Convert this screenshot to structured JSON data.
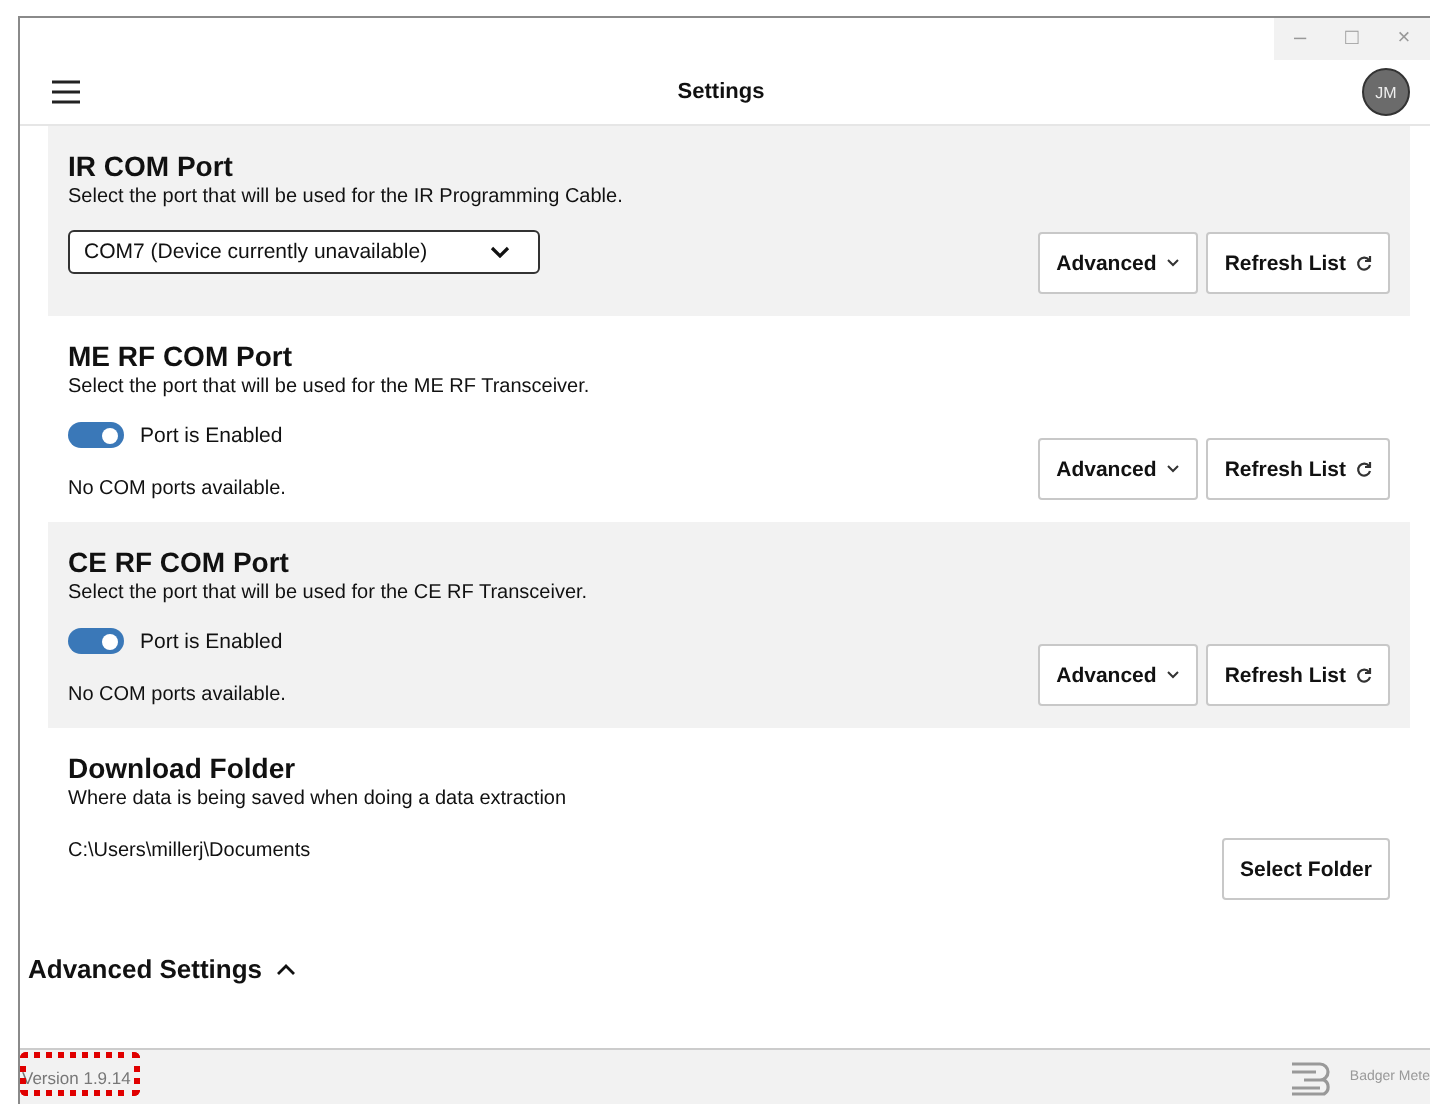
{
  "window": {
    "controls": [
      "–",
      "□",
      "×"
    ]
  },
  "header": {
    "title": "Settings",
    "avatar": "JM"
  },
  "sections": [
    {
      "kind": "dropdown",
      "title": "IR COM Port",
      "description": "Select the port that will be used for the IR Programming Cable.",
      "value": "COM7 (Device currently unavailable)",
      "buttons": [
        {
          "label": "Advanced",
          "kind": "menu"
        },
        {
          "label": "Refresh List",
          "kind": "refresh"
        }
      ]
    },
    {
      "kind": "toggle",
      "title": "ME RF COM Port",
      "description": "Select the port that will be used for the ME RF Transceiver.",
      "toggle": {
        "label": "Port is Enabled",
        "on": true
      },
      "message": "No COM ports available.",
      "buttons": [
        {
          "label": "Advanced",
          "kind": "menu"
        },
        {
          "label": "Refresh List",
          "kind": "refresh"
        }
      ]
    },
    {
      "kind": "toggle",
      "title": "CE RF COM Port",
      "description": "Select the port that will be used for the CE RF Transceiver.",
      "toggle": {
        "label": "Port is Enabled",
        "on": true
      },
      "message": "No COM ports available.",
      "buttons": [
        {
          "label": "Advanced",
          "kind": "menu"
        },
        {
          "label": "Refresh List",
          "kind": "refresh"
        }
      ]
    },
    {
      "kind": "folder",
      "title": "Download Folder",
      "description": "Where data is being saved when doing a data extraction",
      "message": "C:\\Users\\millerj\\Documents",
      "buttons": [
        {
          "label": "Select Folder",
          "kind": "plain"
        }
      ]
    }
  ],
  "advanced_settings": {
    "label": "Advanced Settings",
    "expanded": true
  },
  "footer": {
    "version": "Version 1.9.14",
    "brand": "Badger Mete"
  }
}
